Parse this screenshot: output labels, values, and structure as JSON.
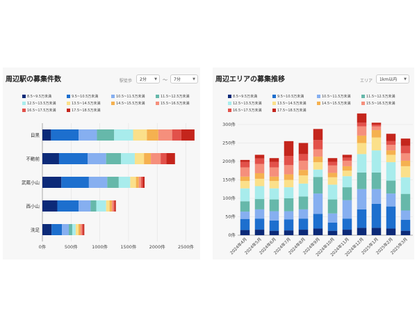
{
  "colors": [
    "#0c2a78",
    "#1d6fce",
    "#86aff0",
    "#66b8aa",
    "#a8ecec",
    "#fbe08a",
    "#f5b150",
    "#f58f7c",
    "#e2514a",
    "#c4251c"
  ],
  "legend_labels": [
    "8.5~9.5万未満",
    "9.5~10.5万未満",
    "10.5~11.5万未満",
    "11.5~12.5万未満",
    "12.5~13.5万未満",
    "13.5~14.5万未満",
    "14.5~15.5万未満",
    "15.5~16.5万未満",
    "16.5~17.5万未満",
    "17.5~18.5万未満"
  ],
  "left": {
    "title": "周辺駅の募集件数",
    "filter_label": "駅徒歩",
    "from_value": "2分",
    "tilde": "～",
    "to_value": "7分"
  },
  "right": {
    "title": "周辺エリアの募集推移",
    "filter_label": "エリア",
    "area_value": "1km以内"
  },
  "chart_data": [
    {
      "type": "bar",
      "orientation": "horizontal",
      "stacked": true,
      "categories": [
        "目黒",
        "不動前",
        "武蔵小山",
        "西小山",
        "洗足"
      ],
      "series": [
        {
          "name": "8.5~9.5万未満",
          "values": [
            150,
            290,
            330,
            260,
            160
          ]
        },
        {
          "name": "9.5~10.5万未満",
          "values": [
            480,
            500,
            480,
            370,
            180
          ]
        },
        {
          "name": "10.5~11.5万未満",
          "values": [
            320,
            320,
            320,
            210,
            120
          ]
        },
        {
          "name": "11.5~12.5万未満",
          "values": [
            300,
            260,
            200,
            100,
            60
          ]
        },
        {
          "name": "12.5~13.5万未満",
          "values": [
            330,
            240,
            200,
            170,
            60
          ]
        },
        {
          "name": "13.5~14.5万未満",
          "values": [
            240,
            160,
            100,
            60,
            50
          ]
        },
        {
          "name": "14.5~15.5万未満",
          "values": [
            200,
            120,
            50,
            40,
            30
          ]
        },
        {
          "name": "15.5~16.5万未満",
          "values": [
            240,
            170,
            40,
            30,
            30
          ]
        },
        {
          "name": "16.5~17.5万未満",
          "values": [
            160,
            100,
            30,
            20,
            20
          ]
        },
        {
          "name": "17.5~18.5万未満",
          "values": [
            230,
            150,
            30,
            20,
            20
          ]
        }
      ],
      "xticks": [
        "0件",
        "500件",
        "1000件",
        "1500件",
        "2000件",
        "2500件"
      ],
      "xlim": [
        0,
        2700
      ],
      "grid": true,
      "legend": "top"
    },
    {
      "type": "bar",
      "orientation": "vertical",
      "stacked": true,
      "categories": [
        "2024年4月",
        "2024年5月",
        "2024年6月",
        "2024年7月",
        "2024年8月",
        "2024年9月",
        "2024年10月",
        "2024年11月",
        "2024年12月",
        "2025年1月",
        "2025年2月",
        "2025年3月"
      ],
      "series": [
        {
          "name": "8.5~9.5万未満",
          "values": [
            14,
            15,
            12,
            13,
            15,
            18,
            12,
            15,
            20,
            20,
            18,
            12
          ]
        },
        {
          "name": "9.5~10.5万未満",
          "values": [
            30,
            30,
            28,
            30,
            30,
            40,
            22,
            30,
            50,
            65,
            60,
            30
          ]
        },
        {
          "name": "10.5~11.5万未満",
          "values": [
            20,
            25,
            25,
            22,
            25,
            55,
            25,
            50,
            55,
            40,
            35,
            25
          ]
        },
        {
          "name": "11.5~12.5万未満",
          "values": [
            28,
            28,
            32,
            35,
            35,
            45,
            38,
            35,
            45,
            45,
            35,
            45
          ]
        },
        {
          "name": "12.5~13.5万未満",
          "values": [
            35,
            35,
            30,
            30,
            35,
            20,
            40,
            30,
            50,
            60,
            50,
            45
          ]
        },
        {
          "name": "13.5~14.5万未満",
          "values": [
            20,
            20,
            20,
            20,
            22,
            20,
            20,
            15,
            30,
            35,
            20,
            30
          ]
        },
        {
          "name": "14.5~15.5万未満",
          "values": [
            12,
            15,
            12,
            15,
            15,
            15,
            12,
            12,
            20,
            20,
            12,
            15
          ]
        },
        {
          "name": "15.5~16.5万未満",
          "values": [
            25,
            25,
            25,
            25,
            25,
            20,
            20,
            15,
            25,
            10,
            15,
            20
          ]
        },
        {
          "name": "16.5~17.5万未満",
          "values": [
            15,
            15,
            15,
            25,
            18,
            25,
            10,
            8,
            10,
            5,
            10,
            20
          ]
        },
        {
          "name": "17.5~18.5万未満",
          "values": [
            5,
            10,
            10,
            40,
            30,
            30,
            10,
            8,
            25,
            5,
            20,
            20
          ]
        }
      ],
      "yticks": [
        "0件",
        "50件",
        "100件",
        "150件",
        "200件",
        "250件",
        "300件"
      ],
      "ylim": [
        0,
        300
      ],
      "grid": true,
      "legend": "top"
    }
  ]
}
